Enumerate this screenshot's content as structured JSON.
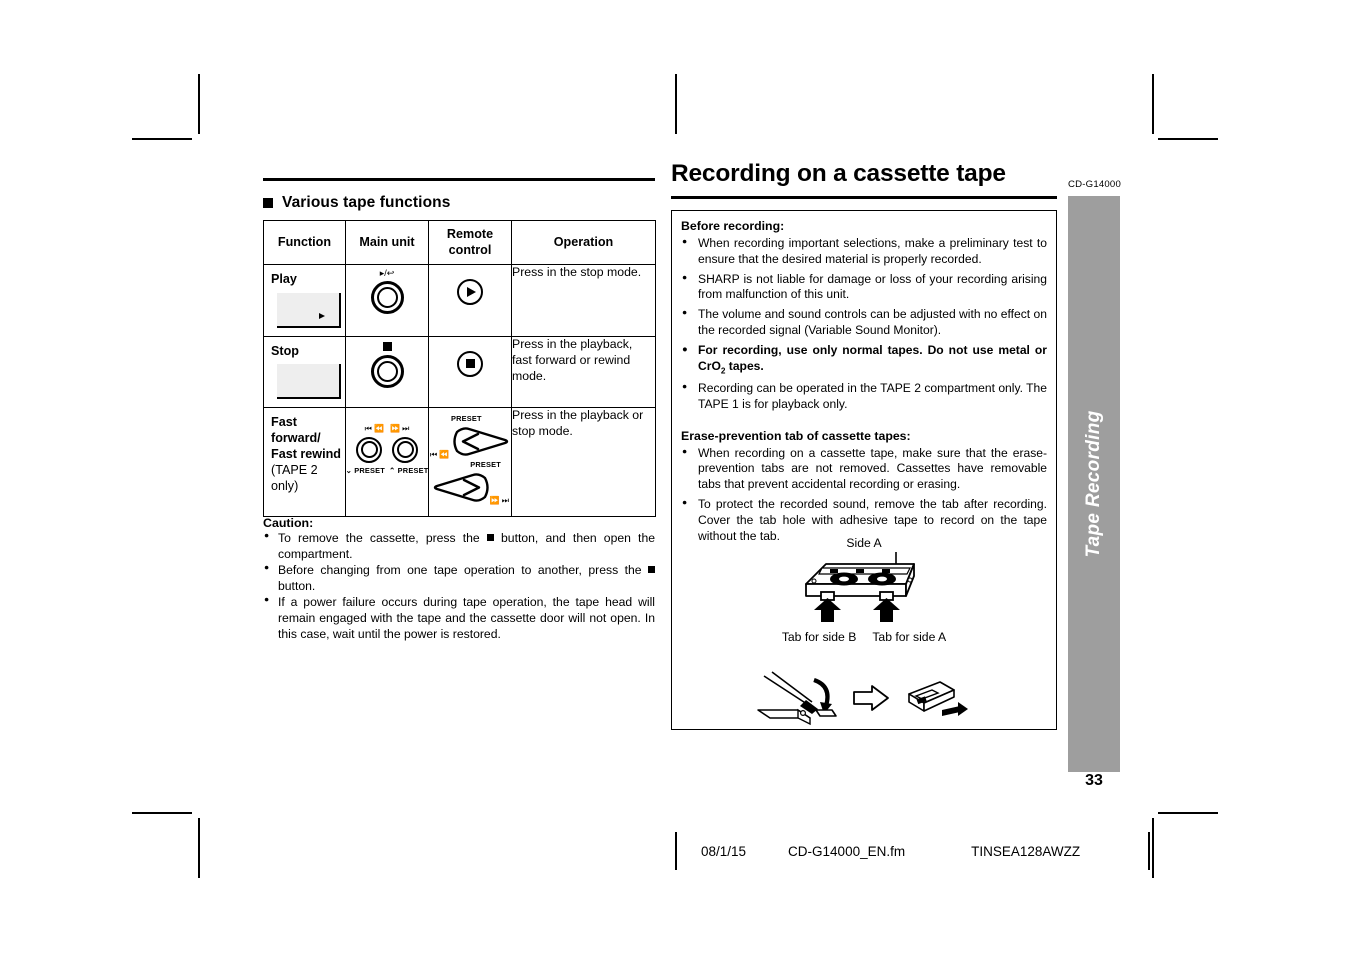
{
  "header": {
    "title": "Recording on a cassette tape",
    "model_code": "CD-G14000"
  },
  "sidebar": {
    "tab_label": "Tape Recording",
    "page_number": "33",
    "tab_color": "#9e9e9e"
  },
  "left_column": {
    "section_heading": "Various tape functions",
    "table": {
      "columns": [
        "Function",
        "Main unit",
        "Remote control",
        "Operation"
      ],
      "rows": [
        {
          "function": "Play",
          "function_sub": "",
          "main_unit_icon": "play-reverse-knob-icon",
          "main_unit_glyph": "▸/↩",
          "remote_icon": "play-button-icon",
          "operation": "Press in the stop mode."
        },
        {
          "function": "Stop",
          "function_sub": "",
          "main_unit_icon": "stop-knob-icon",
          "main_unit_glyph": "■",
          "remote_icon": "stop-button-icon",
          "operation": "Press in the playback, fast forward or rewind mode."
        },
        {
          "function": "Fast forward/ Fast rewind",
          "function_sub": "(TAPE 2 only)",
          "main_unit_icon": "preset-skip-knobs-icon",
          "main_unit_glyph": "",
          "remote_icon": "preset-arrow-pads-icon",
          "operation": "Press in the playback or stop mode."
        }
      ],
      "row3_main_unit": {
        "left_glyph": "⏮ ⏪",
        "right_glyph": "⏩ ⏭",
        "left_label": "PRESET",
        "right_label": "PRESET"
      },
      "row3_remote": {
        "top_label": "PRESET",
        "top_glyph": "⏮ ⏪",
        "bottom_label": "PRESET",
        "bottom_glyph": "⏩ ⏭"
      }
    },
    "caution": {
      "heading": "Caution:",
      "items": [
        {
          "pre": "To remove the cassette, press the ",
          "post": " button, and then open the compartment."
        },
        {
          "pre": "Before changing from one tape operation to another, press the ",
          "post": " button."
        },
        {
          "pre": "If a power failure occurs during tape operation, the tape head will remain engaged with the tape and the cassette door will not open. In this case, wait until the power is restored.",
          "post": ""
        }
      ]
    }
  },
  "right_column": {
    "before_recording": {
      "heading": "Before recording:",
      "items": [
        "When recording important selections, make a preliminary test to ensure that the desired material is properly recorded.",
        "SHARP is not liable for damage or loss of your recording arising from malfunction of this unit.",
        "The volume and sound controls can be adjusted with no effect on the recorded signal (Variable Sound Monitor).",
        "Recording can be operated in the TAPE 2 compartment only. The TAPE 1 is for playback only."
      ],
      "bold_item_pre": "For recording, use only normal tapes. Do not use metal or CrO",
      "bold_item_sub": "2",
      "bold_item_post": " tapes."
    },
    "erase_prevention": {
      "heading": "Erase-prevention tab of cassette tapes:",
      "items": [
        "When recording on a cassette tape, make sure that the erase-prevention tabs are not removed. Cassettes have removable tabs that prevent accidental recording or erasing.",
        "To protect the recorded sound, remove the tab after recording. Cover the tab hole with adhesive tape to record on the tape without the tab."
      ]
    },
    "diagram": {
      "side_label": "Side A",
      "tab_b_label": "Tab for side B",
      "tab_a_label": "Tab for side A"
    }
  },
  "footer": {
    "date": "08/1/15",
    "filename": "CD-G14000_EN.fm",
    "code": "TINSEA128AWZZ"
  }
}
